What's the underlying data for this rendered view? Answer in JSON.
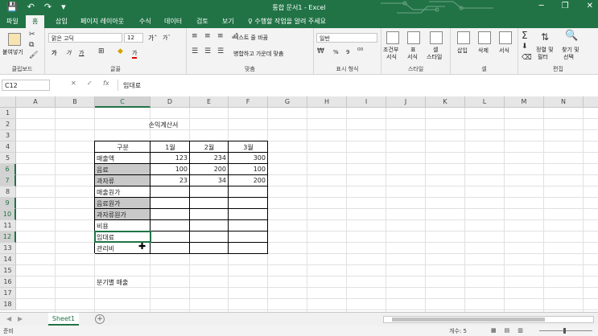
{
  "window": {
    "title": "통합 문서1 - Excel",
    "qat": [
      "💾",
      "↶",
      "↷",
      "▾"
    ],
    "controls": [
      "─",
      "❐",
      "✕"
    ]
  },
  "tabs": [
    "파일",
    "홈",
    "삽입",
    "페이지 레이아웃",
    "수식",
    "데이터",
    "검토",
    "보기"
  ],
  "tell_me": "♀ 수행할 작업을 알려 주세요",
  "ribbon": {
    "clipboard": {
      "paste": "붙여넣기",
      "label": "클립보드"
    },
    "font": {
      "name": "맑은 고딕",
      "size": "12",
      "grow": "가ˆ",
      "shrink": "가ˇ",
      "bold": "가",
      "italic": "가",
      "underline": "가",
      "font_color": "가",
      "label": "글꼴"
    },
    "alignment": {
      "wrap": "텍스트 줄 바꿈",
      "merge": "병합하고 가운데 맞춤",
      "label": "맞춤"
    },
    "number": {
      "format": "일반",
      "percent": "%",
      "comma": "9",
      "label": "표시 형식"
    },
    "styles": {
      "conditional": [
        "조건부",
        "서식"
      ],
      "table": [
        "표",
        "서식"
      ],
      "cell": [
        "셀",
        "스타일"
      ],
      "label": "스타일"
    },
    "cells": {
      "insert": "삽입",
      "delete": "삭제",
      "format": "서식",
      "label": "셀"
    },
    "editing": {
      "sum": "Σ",
      "sort": [
        "정렬 및",
        "필터"
      ],
      "find": [
        "찾기 및",
        "선택"
      ],
      "label": "편집"
    }
  },
  "formula_bar": {
    "name_box": "C12",
    "cancel": "✕",
    "enter": "✓",
    "fx": "fx",
    "content": "임대료"
  },
  "columns": [
    "A",
    "B",
    "C",
    "D",
    "E",
    "F",
    "G",
    "H",
    "I",
    "J",
    "K",
    "L",
    "M",
    "N",
    "O"
  ],
  "rows": [
    "1",
    "2",
    "3",
    "4",
    "5",
    "6",
    "7",
    "8",
    "9",
    "10",
    "11",
    "12",
    "13",
    "14",
    "15",
    "16",
    "17",
    "18"
  ],
  "selected_column": "C",
  "selected_rows": [
    "6",
    "7",
    "9",
    "10",
    "12"
  ],
  "sheet": {
    "title": "손익계산서",
    "header": [
      "구분",
      "1월",
      "2월",
      "3월"
    ],
    "rows": [
      {
        "label": "매출액",
        "values": [
          "123",
          "234",
          "300"
        ]
      },
      {
        "label": "음료",
        "values": [
          "100",
          "200",
          "100"
        ]
      },
      {
        "label": "과자류",
        "values": [
          "23",
          "34",
          "200"
        ]
      },
      {
        "label": "매출원가",
        "values": [
          "",
          "",
          ""
        ]
      },
      {
        "label": "음료원가",
        "values": [
          "",
          "",
          ""
        ]
      },
      {
        "label": "과자류원가",
        "values": [
          "",
          "",
          ""
        ]
      },
      {
        "label": "비용",
        "values": [
          "",
          "",
          ""
        ]
      },
      {
        "label": "임대료",
        "values": [
          "",
          "",
          ""
        ]
      },
      {
        "label": "관리비",
        "values": [
          "",
          "",
          ""
        ]
      }
    ],
    "quarterly_label": "분기별 매출"
  },
  "sheet_tabs": [
    "Sheet1"
  ],
  "status": {
    "ready": "준비",
    "count": "개수: 5"
  }
}
